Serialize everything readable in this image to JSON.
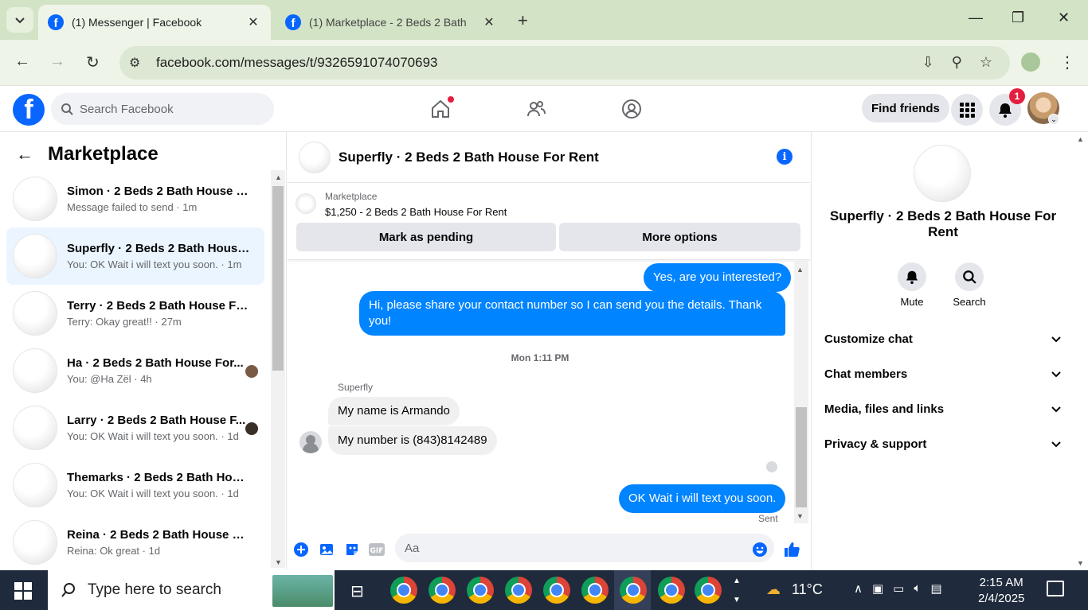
{
  "browser": {
    "tabs": [
      {
        "title": "(1) Messenger | Facebook",
        "active": true
      },
      {
        "title": "(1) Marketplace - 2 Beds 2 Bath",
        "active": false
      }
    ],
    "url": "facebook.com/messages/t/9326591074070693"
  },
  "fbnav": {
    "search_placeholder": "Search Facebook",
    "find_friends": "Find friends",
    "notification_count": "1"
  },
  "left": {
    "title": "Marketplace",
    "chats": [
      {
        "name": "Simon · 2 Beds 2 Bath House F...",
        "sub": "Message failed to send · 1m",
        "selected": false,
        "seen": false
      },
      {
        "name": "Superfly · 2 Beds 2 Bath House ...",
        "sub": "You: OK Wait i will text you soon. · 1m",
        "selected": true,
        "seen": false
      },
      {
        "name": "Terry · 2 Beds 2 Bath House For...",
        "sub": "Terry: Okay great!! · 27m",
        "selected": false,
        "seen": false
      },
      {
        "name": "Ha · 2 Beds 2 Bath House For...",
        "sub": "You: @Ha Zël · 4h",
        "selected": false,
        "seen": true
      },
      {
        "name": "Larry · 2 Beds 2 Bath House F...",
        "sub": "You: OK Wait i will text you soon. · 1d",
        "selected": false,
        "seen": true
      },
      {
        "name": "Themarks · 2 Beds 2 Bath Hous...",
        "sub": "You: OK Wait i will text you soon. · 1d",
        "selected": false,
        "seen": false
      },
      {
        "name": "Reina · 2 Beds 2 Bath House Fo...",
        "sub": "Reina: Ok great · 1d",
        "selected": false,
        "seen": false
      }
    ]
  },
  "conversation": {
    "title": "Superfly · 2 Beds 2 Bath House For Rent",
    "listing_category": "Marketplace",
    "listing_title": "$1,250 - 2 Beds 2 Bath House For Rent",
    "mark_pending": "Mark as pending",
    "more_options": "More options",
    "messages": {
      "out1": "Yes, are you interested?",
      "out2": "Hi, please share your contact number so I can send you the details. Thank you!",
      "timestamp": "Mon 1:11 PM",
      "sender": "Superfly",
      "in1": "My name is Armando",
      "in2": "My number is (843)8142489",
      "out3": "OK Wait i will text you soon.",
      "status": "Sent"
    },
    "composer_placeholder": "Aa"
  },
  "right": {
    "name": "Superfly · 2 Beds 2 Bath House For Rent",
    "actions": [
      "Mute",
      "Search"
    ],
    "sections": [
      "Customize chat",
      "Chat members",
      "Media, files and links",
      "Privacy & support"
    ]
  },
  "taskbar": {
    "search_text": "Type here to search",
    "temperature": "11°C",
    "time": "2:15 AM",
    "date": "2/4/2025"
  }
}
